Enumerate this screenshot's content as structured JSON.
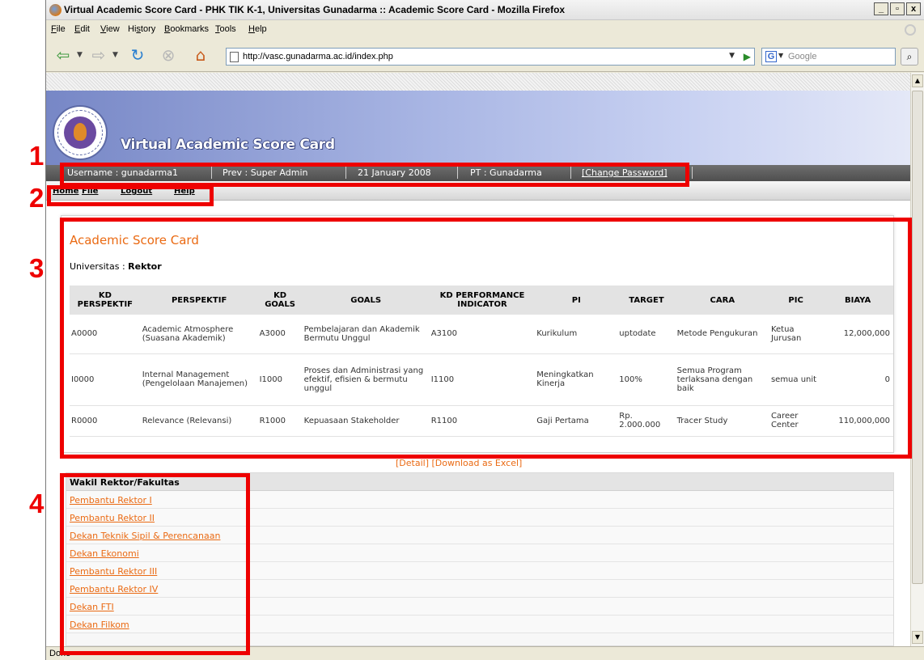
{
  "window": {
    "title": "Virtual Academic Score Card - PHK TIK K-1, Universitas Gunadarma :: Academic Score Card - Mozilla Firefox",
    "controls": [
      "_",
      "▫",
      "x"
    ]
  },
  "menubar": {
    "items": [
      {
        "prefix": "",
        "u": "F",
        "rest": "ile"
      },
      {
        "prefix": "",
        "u": "E",
        "rest": "dit"
      },
      {
        "prefix": "",
        "u": "V",
        "rest": "iew"
      },
      {
        "prefix": "Hi",
        "u": "s",
        "rest": "tory"
      },
      {
        "prefix": "",
        "u": "B",
        "rest": "ookmarks"
      },
      {
        "prefix": "",
        "u": "T",
        "rest": "ools"
      },
      {
        "prefix": "",
        "u": "H",
        "rest": "elp"
      }
    ]
  },
  "navbar": {
    "url": "http://vasc.gunadarma.ac.id/index.php",
    "search_engine": "G",
    "search_placeholder": "Google"
  },
  "statusbar": {
    "text": "Done"
  },
  "banner": {
    "brand": "Virtual Academic Score Card"
  },
  "infobar": {
    "username": "Username : gunadarma1",
    "prev": "Prev : Super Admin",
    "date": "21 January 2008",
    "pt": "PT : Gunadarma",
    "change_password": "[Change Password]"
  },
  "navlinks": [
    "Home",
    "File",
    "Logout",
    "Help"
  ],
  "scorecard": {
    "title": "Academic Score Card",
    "university_label": "Universitas : ",
    "university_value": "Rektor",
    "columns": [
      "KD PERSPEKTIF",
      "PERSPEKTIF",
      "KD GOALS",
      "GOALS",
      "KD PERFORMANCE INDICATOR",
      "PI",
      "TARGET",
      "CARA",
      "PIC",
      "BIAYA"
    ],
    "rows": [
      [
        "A0000",
        "Academic Atmosphere (Suasana Akademik)",
        "A3000",
        "Pembelajaran dan Akademik Bermutu Unggul",
        "A3100",
        "Kurikulum",
        "uptodate",
        "Metode Pengukuran",
        "Ketua Jurusan",
        "12,000,000"
      ],
      [
        "I0000",
        "Internal Management (Pengelolaan Manajemen)",
        "I1000",
        "Proses dan Administrasi yang efektif, efisien & bermutu unggul",
        "I1100",
        "Meningkatkan Kinerja",
        "100%",
        "Semua Program terlaksana dengan baik",
        "semua unit",
        "0"
      ],
      [
        "R0000",
        "Relevance (Relevansi)",
        "R1000",
        "Kepuasaan Stakeholder",
        "R1100",
        "Gaji Pertama",
        "Rp. 2.000.000",
        "Tracer Study",
        "Career Center",
        "110,000,000"
      ]
    ],
    "links": "[Detail] [Download as Excel]"
  },
  "wakil": {
    "header": "Wakil Rektor/Fakultas",
    "items": [
      "Pembantu Rektor I",
      "Pembantu Rektor II",
      "Dekan Teknik Sipil & Perencanaan",
      "Dekan Ekonomi",
      "Pembantu Rektor III",
      "Pembantu Rektor IV",
      "Dekan FTI",
      "Dekan Filkom"
    ]
  },
  "annotations": [
    "1",
    "2",
    "3",
    "4"
  ],
  "colors": {
    "accent": "#ea6a13",
    "annotation": "#ee0000",
    "infobar": "#5e5e5e",
    "banner": "#8c9ad2"
  }
}
